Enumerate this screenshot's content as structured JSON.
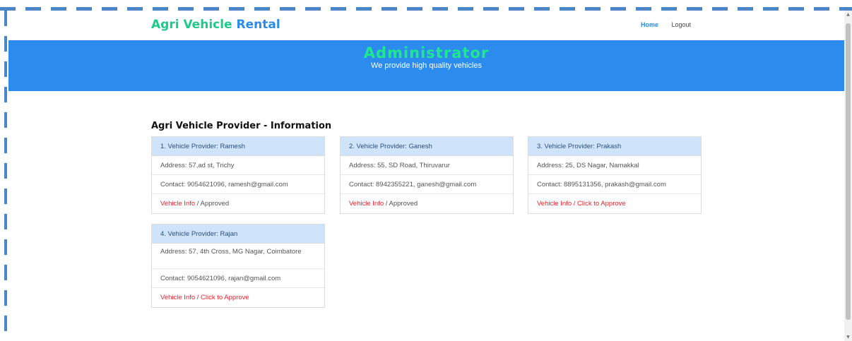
{
  "header": {
    "brand_part1": "Agri Vehicle",
    "brand_part2": "Rental",
    "nav": {
      "home": "Home",
      "logout": "Logout"
    }
  },
  "hero": {
    "title": "Administrator",
    "subtitle": "We provide high quality vehicles"
  },
  "section": {
    "title": "Agri Vehicle Provider - Information"
  },
  "providers": [
    {
      "header": "1. Vehicle Provider: Ramesh",
      "address": "Address: 57,ad st, Trichy",
      "contact": "Contact: 9054621096, ramesh@gmail.com",
      "vehicle_info": "Vehicle Info",
      "separator": "/",
      "status": "Approved"
    },
    {
      "header": "2. Vehicle Provider: Ganesh",
      "address": "Address: 55, SD Road, Thiruvarur",
      "contact": "Contact: 8942355221, ganesh@gmail.com",
      "vehicle_info": "Vehicle Info",
      "separator": "/",
      "status": "Approved"
    },
    {
      "header": "3. Vehicle Provider: Prakash",
      "address": "Address: 25, DS Nagar, Namakkal",
      "contact": "Contact: 8895131356, prakash@gmail.com",
      "vehicle_info": "Vehicle Info",
      "separator": "/",
      "status": "Click to Approve"
    },
    {
      "header": "4. Vehicle Provider: Rajan",
      "address": "Address: 57, 4th Cross, MG Nagar, Coimbatore",
      "contact": "Contact: 9054621096, rajan@gmail.com",
      "vehicle_info": "Vehicle Info",
      "separator": "/",
      "status": "Click to Approve"
    }
  ],
  "colors": {
    "brand_green": "#1ec98a",
    "brand_blue": "#2a8be8",
    "hero_bg": "#2b8ced",
    "hero_title": "#1ee78e",
    "card_header_bg": "#cfe3fa",
    "link_red": "#ef1f2a"
  }
}
